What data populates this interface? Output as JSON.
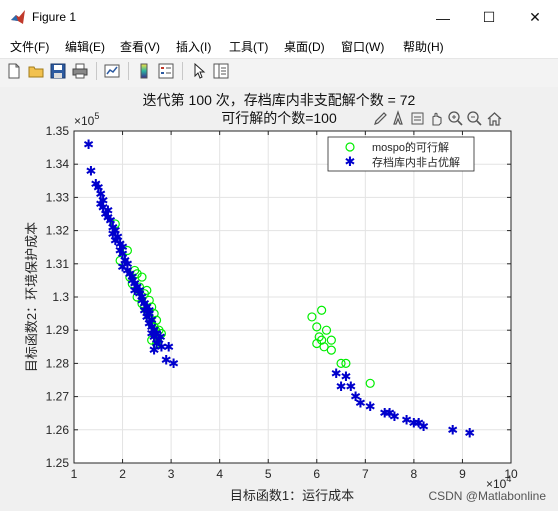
{
  "window": {
    "title": "Figure 1",
    "minimize": "—",
    "maximize": "☐",
    "close": "✕"
  },
  "menu": [
    {
      "label": "文件(F)"
    },
    {
      "label": "编辑(E)"
    },
    {
      "label": "查看(V)"
    },
    {
      "label": "插入(I)"
    },
    {
      "label": "工具(T)"
    },
    {
      "label": "桌面(D)"
    },
    {
      "label": "窗口(W)"
    },
    {
      "label": "帮助(H)"
    }
  ],
  "toolbar_icons": [
    "new-figure-icon",
    "open-folder-icon",
    "save-icon",
    "print-icon",
    "link-plot-icon",
    "colorbar-icon",
    "legend-icon",
    "pointer-icon",
    "property-inspector-icon"
  ],
  "axes_toolbar_icons": [
    "brush-icon",
    "data-tips-icon",
    "export-icon",
    "pan-icon",
    "zoom-in-icon",
    "zoom-out-icon",
    "home-icon"
  ],
  "figure": {
    "title_line1": "迭代第 100 次，存档库内非支配解个数 = 72",
    "title_line2": "可行解的个数=100"
  },
  "watermark": "CSDN @Matlabonline",
  "chart_data": {
    "type": "scatter",
    "xlabel": "目标函数1：运行成本",
    "ylabel": "目标函数2：环境保护成本",
    "x_exponent": "×10^4",
    "y_exponent": "×10^5",
    "xlim": [
      1,
      10
    ],
    "ylim": [
      1.25,
      1.35
    ],
    "x_ticks": [
      1,
      2,
      3,
      4,
      5,
      6,
      7,
      8,
      9,
      10
    ],
    "y_ticks": [
      1.25,
      1.26,
      1.27,
      1.28,
      1.29,
      1.3,
      1.31,
      1.32,
      1.33,
      1.34,
      1.35
    ],
    "grid": true,
    "legend_position": "top-right",
    "series": [
      {
        "name": "mospo的可行解",
        "marker": "circle",
        "color": "#00ee00",
        "points": [
          [
            1.85,
            1.322
          ],
          [
            2.1,
            1.314
          ],
          [
            1.95,
            1.311
          ],
          [
            2.25,
            1.308
          ],
          [
            2.15,
            1.306
          ],
          [
            2.3,
            1.307
          ],
          [
            2.4,
            1.306
          ],
          [
            2.2,
            1.304
          ],
          [
            2.35,
            1.303
          ],
          [
            2.5,
            1.302
          ],
          [
            2.45,
            1.301
          ],
          [
            2.55,
            1.299
          ],
          [
            2.6,
            1.297
          ],
          [
            2.5,
            1.296
          ],
          [
            2.65,
            1.295
          ],
          [
            2.55,
            1.294
          ],
          [
            2.7,
            1.293
          ],
          [
            2.6,
            1.292
          ],
          [
            2.65,
            1.291
          ],
          [
            2.75,
            1.29
          ],
          [
            2.7,
            1.289
          ],
          [
            2.8,
            1.289
          ],
          [
            2.6,
            1.287
          ],
          [
            2.7,
            1.286
          ],
          [
            2.4,
            1.298
          ],
          [
            2.3,
            1.3
          ],
          [
            2.45,
            1.297
          ],
          [
            2.58,
            1.293
          ],
          [
            2.68,
            1.29
          ],
          [
            2.72,
            1.287
          ],
          [
            5.9,
            1.294
          ],
          [
            6.1,
            1.296
          ],
          [
            6.0,
            1.291
          ],
          [
            6.05,
            1.288
          ],
          [
            6.2,
            1.29
          ],
          [
            6.1,
            1.287
          ],
          [
            6.3,
            1.287
          ],
          [
            6.0,
            1.286
          ],
          [
            6.15,
            1.285
          ],
          [
            6.3,
            1.284
          ],
          [
            6.5,
            1.28
          ],
          [
            6.6,
            1.28
          ],
          [
            7.1,
            1.274
          ]
        ]
      },
      {
        "name": "存档库内非占优解",
        "marker": "star",
        "color": "#0000cc",
        "points": [
          [
            1.3,
            1.346
          ],
          [
            1.35,
            1.338
          ],
          [
            1.45,
            1.334
          ],
          [
            1.5,
            1.333
          ],
          [
            1.55,
            1.331
          ],
          [
            1.6,
            1.329
          ],
          [
            1.55,
            1.328
          ],
          [
            1.6,
            1.327
          ],
          [
            1.65,
            1.325
          ],
          [
            1.7,
            1.324
          ],
          [
            1.75,
            1.323
          ],
          [
            1.8,
            1.321
          ],
          [
            1.85,
            1.32
          ],
          [
            1.8,
            1.319
          ],
          [
            1.9,
            1.318
          ],
          [
            1.85,
            1.317
          ],
          [
            1.95,
            1.316
          ],
          [
            2.0,
            1.315
          ],
          [
            2.0,
            1.313
          ],
          [
            2.05,
            1.311
          ],
          [
            2.1,
            1.31
          ],
          [
            2.0,
            1.309
          ],
          [
            2.1,
            1.308
          ],
          [
            2.15,
            1.307
          ],
          [
            2.2,
            1.306
          ],
          [
            2.25,
            1.304
          ],
          [
            2.3,
            1.303
          ],
          [
            2.25,
            1.302
          ],
          [
            2.35,
            1.301
          ],
          [
            2.4,
            1.3
          ],
          [
            2.4,
            1.299
          ],
          [
            2.45,
            1.298
          ],
          [
            2.5,
            1.297
          ],
          [
            2.45,
            1.296
          ],
          [
            2.55,
            1.295
          ],
          [
            2.5,
            1.294
          ],
          [
            2.6,
            1.293
          ],
          [
            2.55,
            1.292
          ],
          [
            2.6,
            1.291
          ],
          [
            2.65,
            1.29
          ],
          [
            2.7,
            1.289
          ],
          [
            2.65,
            1.288
          ],
          [
            2.75,
            1.287
          ],
          [
            2.7,
            1.286
          ],
          [
            2.8,
            1.285
          ],
          [
            2.95,
            1.285
          ],
          [
            2.65,
            1.284
          ],
          [
            2.9,
            1.281
          ],
          [
            3.05,
            1.28
          ],
          [
            6.4,
            1.277
          ],
          [
            6.6,
            1.276
          ],
          [
            6.5,
            1.273
          ],
          [
            6.7,
            1.273
          ],
          [
            6.8,
            1.27
          ],
          [
            6.9,
            1.268
          ],
          [
            7.1,
            1.267
          ],
          [
            7.4,
            1.265
          ],
          [
            7.5,
            1.265
          ],
          [
            7.6,
            1.264
          ],
          [
            7.85,
            1.263
          ],
          [
            8.0,
            1.262
          ],
          [
            8.1,
            1.262
          ],
          [
            8.2,
            1.261
          ],
          [
            8.8,
            1.26
          ],
          [
            9.15,
            1.259
          ],
          [
            2.2,
            1.305
          ],
          [
            2.35,
            1.302
          ],
          [
            1.7,
            1.326
          ],
          [
            1.95,
            1.314
          ],
          [
            2.55,
            1.296
          ],
          [
            2.6,
            1.289
          ],
          [
            2.78,
            1.288
          ]
        ]
      }
    ]
  }
}
